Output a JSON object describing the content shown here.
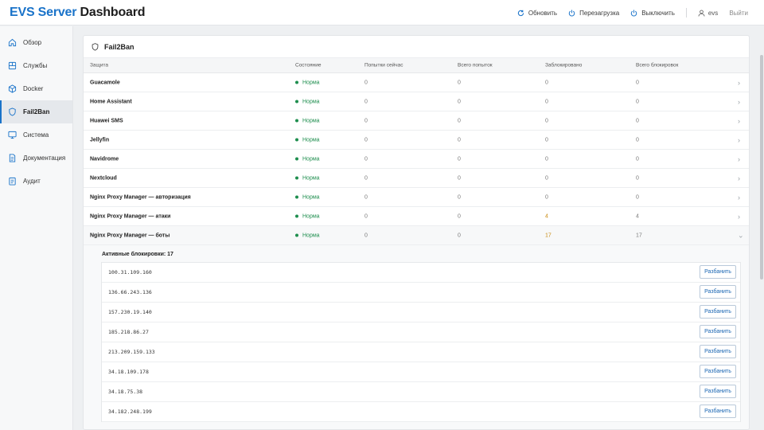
{
  "app": {
    "title_main": "EVS Server",
    "title_suffix": " Dashboard"
  },
  "header": {
    "refresh_label": "Обновить",
    "restart_label": "Перезагрузка",
    "shutdown_label": "Выключить",
    "user_label": "evs",
    "logout_label": "Выйти"
  },
  "sidebar": {
    "items": [
      {
        "label": "Обзор",
        "icon": "home-icon"
      },
      {
        "label": "Службы",
        "icon": "services-icon"
      },
      {
        "label": "Docker",
        "icon": "docker-icon"
      },
      {
        "label": "Fail2Ban",
        "icon": "shield-icon",
        "active": true
      },
      {
        "label": "Система",
        "icon": "monitor-icon"
      },
      {
        "label": "Документация",
        "icon": "document-icon"
      },
      {
        "label": "Аудит",
        "icon": "clipboard-icon"
      }
    ]
  },
  "panel": {
    "title": "Fail2Ban",
    "columns": [
      "Защита",
      "Состояние",
      "Попытки сейчас",
      "Всего попыток",
      "Заблокировано",
      "Всего блокировок"
    ],
    "rows": [
      {
        "name": "Guacamole",
        "status": "Норма",
        "attempts_now": "0",
        "attempts_total": "0",
        "blocked": "0",
        "blocked_total": "0"
      },
      {
        "name": "Home Assistant",
        "status": "Норма",
        "attempts_now": "0",
        "attempts_total": "0",
        "blocked": "0",
        "blocked_total": "0"
      },
      {
        "name": "Huawei SMS",
        "status": "Норма",
        "attempts_now": "0",
        "attempts_total": "0",
        "blocked": "0",
        "blocked_total": "0"
      },
      {
        "name": "Jellyfin",
        "status": "Норма",
        "attempts_now": "0",
        "attempts_total": "0",
        "blocked": "0",
        "blocked_total": "0"
      },
      {
        "name": "Navidrome",
        "status": "Норма",
        "attempts_now": "0",
        "attempts_total": "0",
        "blocked": "0",
        "blocked_total": "0"
      },
      {
        "name": "Nextcloud",
        "status": "Норма",
        "attempts_now": "0",
        "attempts_total": "0",
        "blocked": "0",
        "blocked_total": "0"
      },
      {
        "name": "Nginx Proxy Manager — авторизация",
        "status": "Норма",
        "attempts_now": "0",
        "attempts_total": "0",
        "blocked": "0",
        "blocked_total": "0"
      },
      {
        "name": "Nginx Proxy Manager — атаки",
        "status": "Норма",
        "attempts_now": "0",
        "attempts_total": "0",
        "blocked": "4",
        "blocked_total": "4"
      },
      {
        "name": "Nginx Proxy Manager — боты",
        "status": "Норма",
        "attempts_now": "0",
        "attempts_total": "0",
        "blocked": "17",
        "blocked_total": "17"
      }
    ],
    "active_bans": {
      "title": "Активные блокировки: 17",
      "unban_label": "Разбанить",
      "ips": [
        "100.31.109.160",
        "136.66.243.136",
        "157.230.19.140",
        "185.218.86.27",
        "213.209.159.133",
        "34.18.109.178",
        "34.18.75.38",
        "34.182.248.199"
      ]
    }
  },
  "colors": {
    "accent": "#1a73c9",
    "ok": "#1e8e4e",
    "warn": "#c98a10"
  }
}
